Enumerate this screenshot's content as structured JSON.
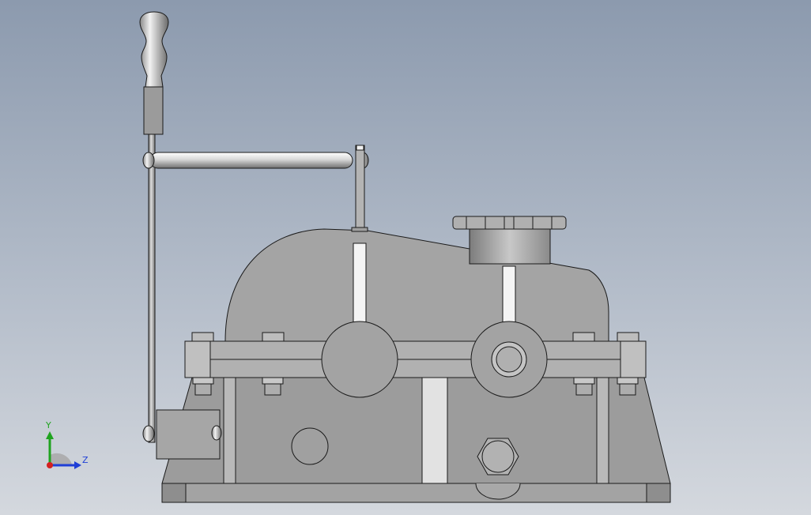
{
  "viewport": {
    "background_top": "#8c9aae",
    "background_bottom": "#d4d8de"
  },
  "triad": {
    "y_label": "Y",
    "z_label": "Z",
    "y_color": "#1fa31f",
    "z_color": "#1f3fd6",
    "x_color": "#d42020"
  },
  "model": {
    "component": "gear-reducer-with-shift-lever",
    "body_color": "#a0a0a0",
    "edge_color": "#1a1a1a"
  }
}
